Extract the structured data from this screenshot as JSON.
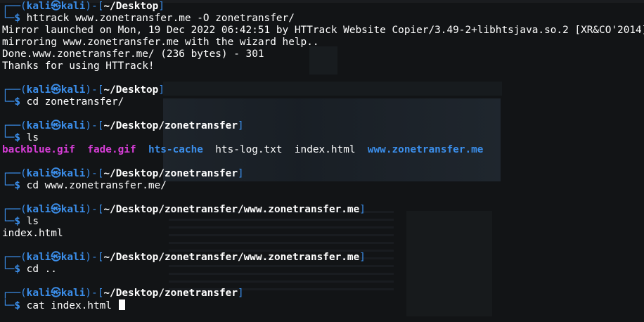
{
  "terminal": {
    "prompt": {
      "user": "kali",
      "host": "kali",
      "at_symbol": "㉿"
    },
    "blocks": [
      {
        "cwd": "~/Desktop",
        "command": "httrack www.zonetransfer.me -O zonetransfer/",
        "output": [
          "Mirror launched on Mon, 19 Dec 2022 06:42:51 by HTTrack Website Copier/3.49-2+libhtsjava.so.2 [XR&CO'2014]",
          "mirroring www.zonetransfer.me with the wizard help..",
          "Done.www.zonetransfer.me/ (236 bytes) - 301",
          "Thanks for using HTTrack!"
        ]
      },
      {
        "cwd": "~/Desktop",
        "command": "cd zonetransfer/"
      },
      {
        "cwd": "~/Desktop/zonetransfer",
        "command": "ls",
        "listing": [
          {
            "name": "backblue.gif",
            "kind": "gif"
          },
          {
            "name": "fade.gif",
            "kind": "gif"
          },
          {
            "name": "hts-cache",
            "kind": "dir"
          },
          {
            "name": "hts-log.txt",
            "kind": "file"
          },
          {
            "name": "index.html",
            "kind": "file"
          },
          {
            "name": "www.zonetransfer.me",
            "kind": "dir"
          }
        ]
      },
      {
        "cwd": "~/Desktop/zonetransfer",
        "command": "cd www.zonetransfer.me/"
      },
      {
        "cwd": "~/Desktop/zonetransfer/www.zonetransfer.me",
        "command": "ls",
        "output": [
          "index.html"
        ]
      },
      {
        "cwd": "~/Desktop/zonetransfer/www.zonetransfer.me",
        "command": "cd .."
      },
      {
        "cwd": "~/Desktop/zonetransfer",
        "command": "cat index.html",
        "active": true
      }
    ]
  },
  "colors": {
    "background": "#121416",
    "prompt_blue": "#3b8eea",
    "gif_magenta": "#d63dd6",
    "text": "#ffffff"
  }
}
